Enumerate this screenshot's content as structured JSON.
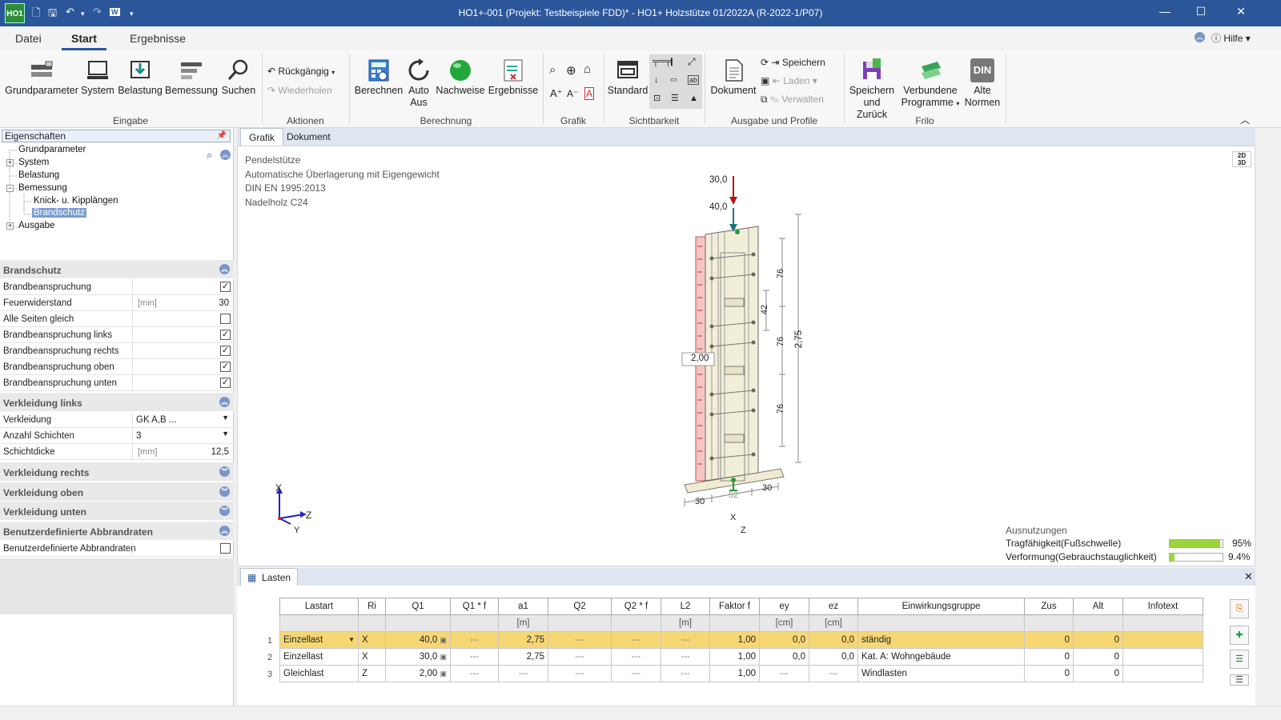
{
  "window": {
    "title": "HO1+-001 (Projekt: Testbeispiele FDD)* - HO1+ Holzstütze 01/2022A (R-2022-1/P07)",
    "app_logo": "HO1"
  },
  "ribbon_tabs": [
    "Datei",
    "Start",
    "Ergebnisse"
  ],
  "help": {
    "label": "Hilfe"
  },
  "ribbon": {
    "eingabe": {
      "label": "Eingabe",
      "buttons": [
        "Grundparameter",
        "System",
        "Belastung",
        "Bemessung",
        "Suchen"
      ]
    },
    "aktionen": {
      "label": "Aktionen",
      "undo": "Rückgängig",
      "redo": "Wiederholen"
    },
    "berechnung": {
      "label": "Berechnung",
      "berechnen": "Berechnen",
      "auto": "Auto",
      "aus": "Aus",
      "nachweise": "Nachweise",
      "ergebnisse": "Ergebnisse"
    },
    "grafik": {
      "label": "Grafik"
    },
    "sichtbarkeit": {
      "label": "Sichtbarkeit",
      "standard": "Standard"
    },
    "ausgabe": {
      "label": "Ausgabe und Profile",
      "dokument": "Dokument",
      "speichern": "Speichern",
      "laden": "Laden",
      "verwalten": "Verwalten"
    },
    "frilo": {
      "label": "Frilo",
      "speichern_zurueck_1": "Speichern",
      "speichern_zurueck_2": "und Zurück",
      "verbundene_1": "Verbundene",
      "verbundene_2": "Programme",
      "alte_1": "Alte",
      "alte_2": "Normen",
      "din": "DIN"
    }
  },
  "left_panel": {
    "header": "Eigenschaften",
    "tree": [
      "Grundparameter",
      "System",
      "Belastung",
      "Bemessung",
      "Knick- u. Kipplängen",
      "Brandschutz",
      "Ausgabe"
    ],
    "sections": {
      "brandschutz": "Brandschutz",
      "verkleidung_links": "Verkleidung links",
      "verkleidung_rechts": "Verkleidung rechts",
      "verkleidung_oben": "Verkleidung oben",
      "verkleidung_unten": "Verkleidung unten",
      "benutzer": "Benutzerdefinierte Abbrandraten"
    },
    "rows": {
      "brandbeanspruchung": {
        "label": "Brandbeanspruchung",
        "checked": true
      },
      "feuerwiderstand": {
        "label": "Feuerwiderstand",
        "unit": "[min]",
        "value": "30"
      },
      "alle_seiten": {
        "label": "Alle Seiten gleich",
        "checked": false
      },
      "links": {
        "label": "Brandbeanspruchung links",
        "checked": true
      },
      "rechts": {
        "label": "Brandbeanspruchung rechts",
        "checked": true
      },
      "oben": {
        "label": "Brandbeanspruchung oben",
        "checked": true
      },
      "unten": {
        "label": "Brandbeanspruchung unten",
        "checked": true
      },
      "verkleidung": {
        "label": "Verkleidung",
        "value": "GK A,B ..."
      },
      "anzahl": {
        "label": "Anzahl Schichten",
        "value": "3"
      },
      "schichtdicke": {
        "label": "Schichtdicke",
        "unit": "[mm]",
        "value": "12,5"
      },
      "benutzer": {
        "label": "Benutzerdefinierte Abbrandraten",
        "checked": false
      }
    }
  },
  "doc_tabs": [
    "Grafik",
    "Dokument"
  ],
  "graphic": {
    "info": [
      "Pendelstütze",
      "Automatische Überlagerung mit Eigengewicht",
      "DIN EN 1995:2013",
      "Nadelholz C24"
    ],
    "load_top1": "30,0",
    "load_top2": "40,0",
    "load_side": "2,00",
    "dim_total": "2,75",
    "dim_76a": "76",
    "dim_42": "42",
    "dim_76b": "76",
    "dim_76c": "76",
    "dim_30a": "30",
    "dim_52": "52",
    "dim_30b": "30",
    "axis_x": "X",
    "axis_z": "Z",
    "axis_y": "Y",
    "axis2_x": "X",
    "axis2_z": "Z",
    "view_toggle": "2D 3D",
    "ausnutzungen": {
      "title": "Ausnutzungen",
      "items": [
        {
          "label": "Tragfähigkeit(Fußschwelle)",
          "value": "95%",
          "fill": 0.95,
          "color": "#9bd63a"
        },
        {
          "label": "Verformung(Gebrauchstauglichkeit)",
          "value": "9.4%",
          "fill": 0.094,
          "color": "#9bd63a"
        }
      ]
    }
  },
  "lasten": {
    "title": "Lasten",
    "headers": [
      "Lastart",
      "Ri",
      "Q1",
      "Q1 * f",
      "a1",
      "Q2",
      "Q2 * f",
      "L2",
      "Faktor f",
      "ey",
      "ez",
      "Einwirkungsgruppe",
      "Zus",
      "Alt",
      "Infotext"
    ],
    "units": [
      "",
      "",
      "",
      "",
      "[m]",
      "",
      "",
      "[m]",
      "",
      "[cm]",
      "[cm]",
      "",
      "",
      "",
      ""
    ],
    "rows": [
      {
        "n": "1",
        "lastart": "Einzellast",
        "ri": "X",
        "q1": "40,0",
        "q1f": "---",
        "a1": "2,75",
        "q2": "---",
        "q2f": "---",
        "l2": "---",
        "f": "1,00",
        "ey": "0,0",
        "ez": "0,0",
        "grp": "ständig",
        "zus": "0",
        "alt": "0",
        "info": ""
      },
      {
        "n": "2",
        "lastart": "Einzellast",
        "ri": "X",
        "q1": "30,0",
        "q1f": "---",
        "a1": "2,75",
        "q2": "---",
        "q2f": "---",
        "l2": "---",
        "f": "1,00",
        "ey": "0,0",
        "ez": "0,0",
        "grp": "Kat. A: Wohngebäude",
        "zus": "0",
        "alt": "0",
        "info": ""
      },
      {
        "n": "3",
        "lastart": "Gleichlast",
        "ri": "Z",
        "q1": "2,00",
        "q1f": "---",
        "a1": "---",
        "q2": "---",
        "q2f": "---",
        "l2": "---",
        "f": "1,00",
        "ey": "---",
        "ez": "---",
        "grp": "Windlasten",
        "zus": "0",
        "alt": "0",
        "info": ""
      }
    ]
  }
}
